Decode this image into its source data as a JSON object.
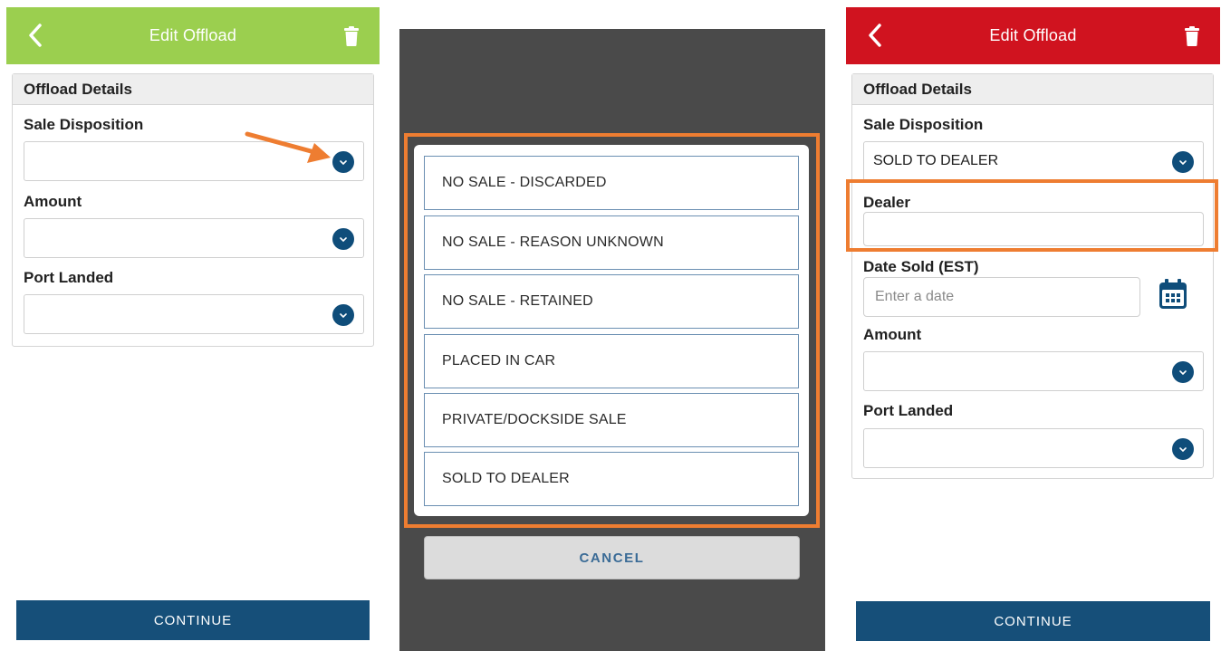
{
  "colors": {
    "header_green": "#9bcf4f",
    "header_red": "#d0131f",
    "primary_blue": "#164f79",
    "annotation_orange": "#ee7d31",
    "overlay_gray": "#4a4a4a"
  },
  "icons": {
    "back": "chevron-left-icon",
    "trash": "trash-icon",
    "dropdown": "chevron-down-icon",
    "calendar": "calendar-icon",
    "annotation": "arrow-icon"
  },
  "screen1": {
    "header_title": "Edit Offload",
    "section_title": "Offload Details",
    "sale_disposition_label": "Sale Disposition",
    "sale_disposition_value": "",
    "amount_label": "Amount",
    "amount_value": "",
    "port_landed_label": "Port Landed",
    "port_landed_value": "",
    "continue_label": "CONTINUE"
  },
  "screen2": {
    "options": [
      "NO SALE - DISCARDED",
      "NO SALE - REASON UNKNOWN",
      "NO SALE - RETAINED",
      "PLACED IN CAR",
      "PRIVATE/DOCKSIDE SALE",
      "SOLD TO DEALER"
    ],
    "cancel_label": "CANCEL"
  },
  "screen3": {
    "header_title": "Edit Offload",
    "section_title": "Offload Details",
    "sale_disposition_label": "Sale Disposition",
    "sale_disposition_value": "SOLD TO DEALER",
    "dealer_label": "Dealer",
    "dealer_value": "",
    "date_sold_label": "Date Sold (EST)",
    "date_sold_placeholder": "Enter a date",
    "amount_label": "Amount",
    "amount_value": "",
    "port_landed_label": "Port Landed",
    "port_landed_value": "",
    "continue_label": "CONTINUE"
  }
}
